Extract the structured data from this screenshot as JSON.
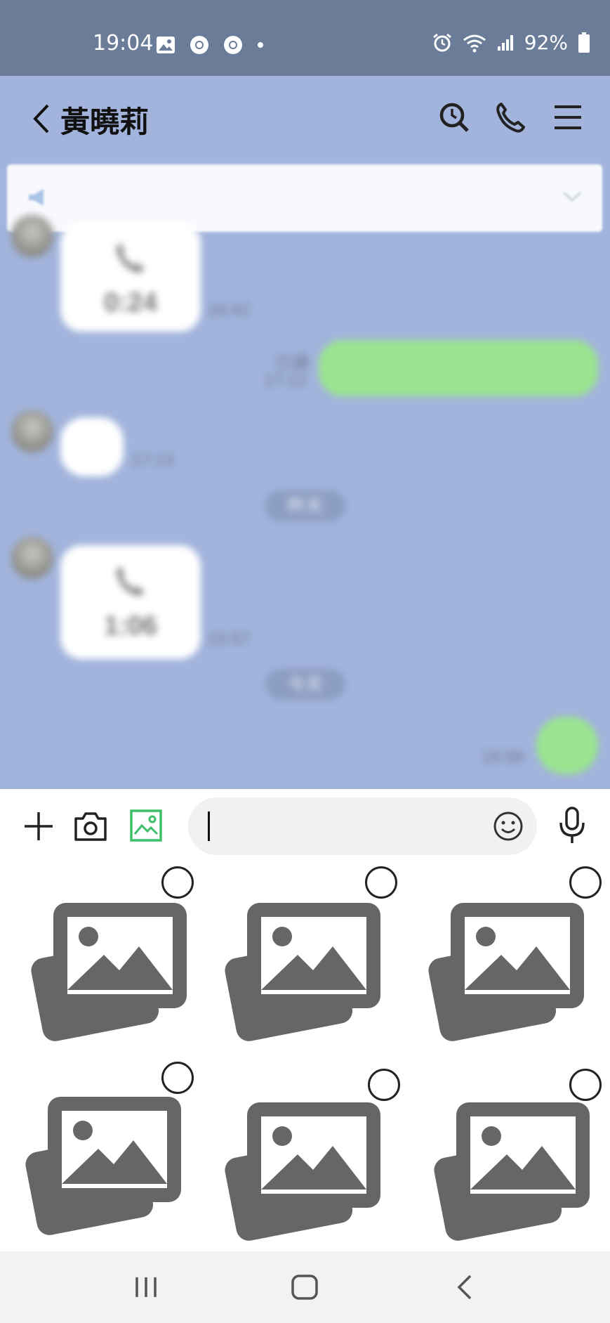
{
  "status_bar": {
    "time": "19:04",
    "battery_percent": "92%"
  },
  "chat": {
    "title": "黃曉莉",
    "messages": [
      {
        "type": "call",
        "side": "left",
        "duration": "0:24",
        "time": "16:42"
      },
      {
        "type": "text",
        "side": "right",
        "read_label": "已讀",
        "time": "17:12"
      },
      {
        "type": "text",
        "side": "left",
        "time": "17:13"
      },
      {
        "type": "date",
        "label": "昨天"
      },
      {
        "type": "call",
        "side": "left",
        "duration": "1:06",
        "time": "15:57"
      },
      {
        "type": "date",
        "label": "今天"
      },
      {
        "type": "text",
        "side": "right",
        "time": "18:58"
      }
    ]
  },
  "input": {
    "value": "",
    "placeholder": ""
  },
  "gallery": {
    "items": 6
  },
  "colors": {
    "chat_background": "#a2b4dc",
    "status_bar": "#6a7c98",
    "sent_bubble": "#9be48f",
    "gallery_icon_active": "#3fbf6a"
  }
}
